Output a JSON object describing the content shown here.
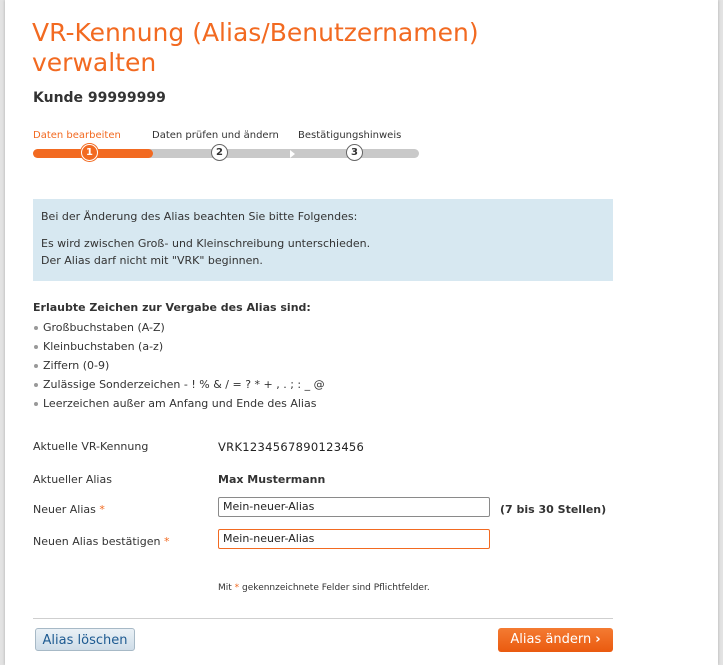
{
  "page": {
    "title": "VR-Kennung (Alias/Benutzernamen) verwalten",
    "customer": "Kunde 99999999"
  },
  "stepper": {
    "steps": [
      {
        "label": "Daten bearbeiten",
        "number": "1",
        "state": "active"
      },
      {
        "label": "Daten prüfen und ändern",
        "number": "2",
        "state": "pending"
      },
      {
        "label": "Bestätigungshinweis",
        "number": "3",
        "state": "pending"
      }
    ]
  },
  "notice": {
    "intro": "Bei der Änderung des Alias beachten Sie bitte Folgendes:",
    "line1": "Es wird zwischen Groß- und Kleinschreibung unterschieden.",
    "line2": "Der Alias darf nicht mit \"VRK\" beginnen."
  },
  "allowed": {
    "title": "Erlaubte Zeichen zur Vergabe des Alias sind:",
    "items": [
      "Großbuchstaben (A-Z)",
      "Kleinbuchstaben (a-z)",
      "Ziffern (0-9)",
      "Zulässige Sonderzeichen - ! % & / = ? * + , . ; : _ @",
      "Leerzeichen außer am Anfang und Ende des Alias"
    ]
  },
  "form": {
    "current_id_label": "Aktuelle VR-Kennung",
    "current_id_value": "VRK1234567890123456",
    "current_alias_label": "Aktueller Alias",
    "current_alias_value": "Max Mustermann",
    "new_alias_label": "Neuer Alias",
    "new_alias_value": "Mein-neuer-Alias",
    "new_alias_hint": "(7 bis 30 Stellen)",
    "confirm_alias_label": "Neuen Alias bestätigen",
    "confirm_alias_value": "Mein-neuer-Alias",
    "required_marker": "*",
    "mandatory_prefix": "Mit",
    "mandatory_suffix": "gekennzeichnete Felder sind Pflichtfelder."
  },
  "actions": {
    "delete_label": "Alias löschen",
    "change_label": "Alias ändern",
    "change_icon": "chevron-right-icon"
  },
  "colors": {
    "accent": "#f26a21",
    "notice_bg": "#d7e8f1",
    "secondary_button_text": "#1d5a91"
  }
}
